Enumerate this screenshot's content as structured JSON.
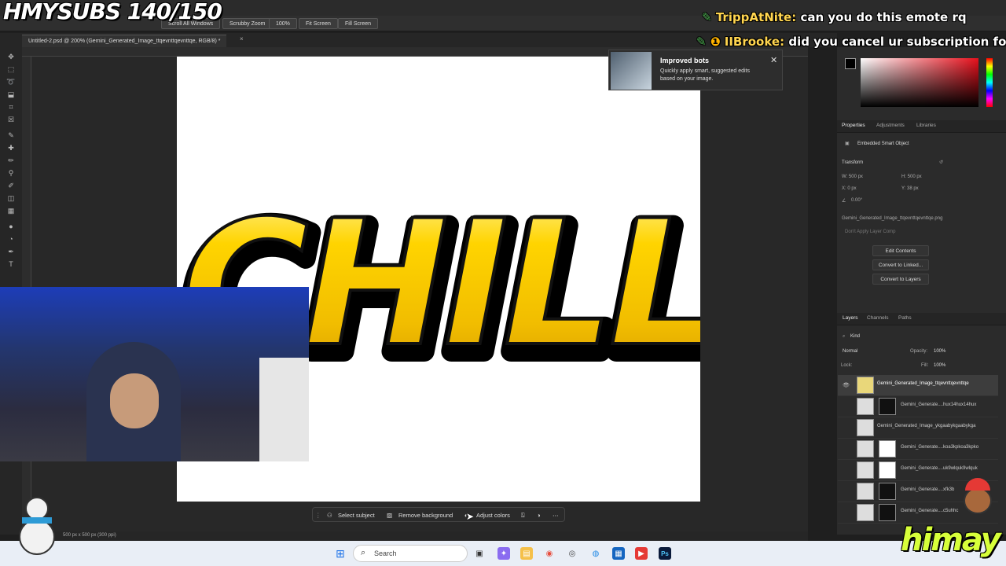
{
  "overlay": {
    "subs": "HMYSUBS 140/150",
    "chat": [
      {
        "user": "TrippAtNite:",
        "message": "can you do this emote rq",
        "user_color": "#ffd54f"
      },
      {
        "user": "IIBrooke:",
        "message": "did you cancel ur subscription fo",
        "user_color": "#ffd54f"
      }
    ],
    "brand": "himay"
  },
  "options_bar": {
    "scroll_all": "Scroll All Windows",
    "scrubby": "Scrubby Zoom",
    "zoom": "100%",
    "fit_screen": "Fit Screen",
    "fill_screen": "Fill Screen"
  },
  "document": {
    "tab_title": "Untitled-2.psd @ 200% (Gemini_Generated_Image_ttqevnttqevnttqe, RGB/8) *",
    "canvas_text": "CHILL",
    "status": "500 px x 500 px (300 ppi)"
  },
  "notification": {
    "title": "Improved bots",
    "body": "Quickly apply smart, suggested edits based on your image."
  },
  "context_bar": {
    "select_subject": "Select subject",
    "remove_background": "Remove background",
    "adjust_colors": "Adjust colors"
  },
  "properties": {
    "tabs": [
      "Properties",
      "Adjustments",
      "Libraries"
    ],
    "type": "Embedded Smart Object",
    "transform_label": "Transform",
    "w": "W: 500 px",
    "h": "H: 500 px",
    "x": "X: 0 px",
    "y": "Y: 38 px",
    "angle": "0.00°",
    "file": "Gemini_Generated_Image_ttqevnttqevnttqe.png",
    "layer_comp": "Don't Apply Layer Comp",
    "buttons": [
      "Edit Contents",
      "Convert to Linked...",
      "Convert to Layers"
    ]
  },
  "layers": {
    "tabs": [
      "Layers",
      "Channels",
      "Paths"
    ],
    "kind": "Kind",
    "blend": "Normal",
    "opacity_label": "Opacity:",
    "opacity": "100%",
    "lock_label": "Lock:",
    "fill_label": "Fill:",
    "fill": "100%",
    "items": [
      "Gemini_Generated_Image_ttqevnttqevnttqe",
      "Gemini_Generate....hux14hux14hux",
      "Gemini_Generated_Image_ykgaabykgaabykga",
      "Gemini_Generate....koa3kpkoa3kpko",
      "Gemini_Generate....uk9wlquk9wlquk",
      "Gemini_Generate....xfk3b",
      "Gemini_Generate....c5uhhc"
    ]
  },
  "taskbar": {
    "search": "Search"
  }
}
